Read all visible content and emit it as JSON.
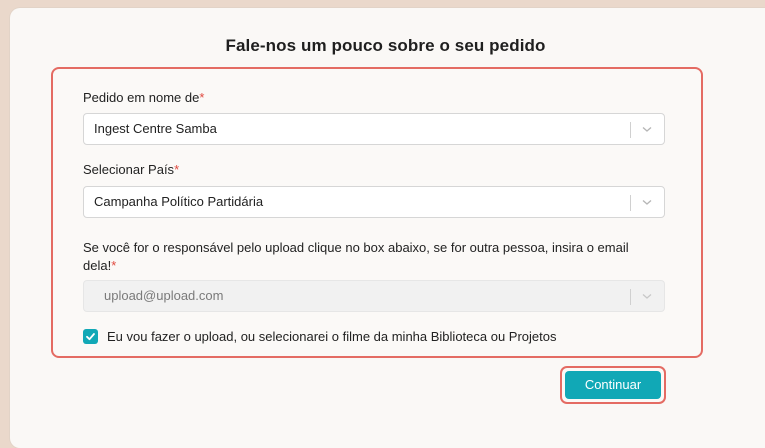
{
  "title": "Fale-nos um pouco sobre o seu pedido",
  "required_mark": "*",
  "field_on_behalf": {
    "label": "Pedido em nome de",
    "value": "Ingest Centre Samba"
  },
  "field_country": {
    "label": "Selecionar País",
    "value": "Campanha Político Partidária"
  },
  "field_email": {
    "label": "Se você for o responsável pelo upload clique no box abaixo, se for outra pessoa, insira o email dela!",
    "value": "upload@upload.com",
    "disabled": true
  },
  "checkbox": {
    "checked": true,
    "label": "Eu vou fazer o upload, ou selecionarei o filme da minha Biblioteca ou Projetos"
  },
  "continue_button": {
    "label": "Continuar"
  },
  "colors": {
    "accent": "#11a8b6",
    "highlight_border": "#e46b63",
    "required": "#e0493f"
  },
  "icons": {
    "select_toggle": "chevron-down-icon",
    "checkbox": "checkmark-icon"
  }
}
